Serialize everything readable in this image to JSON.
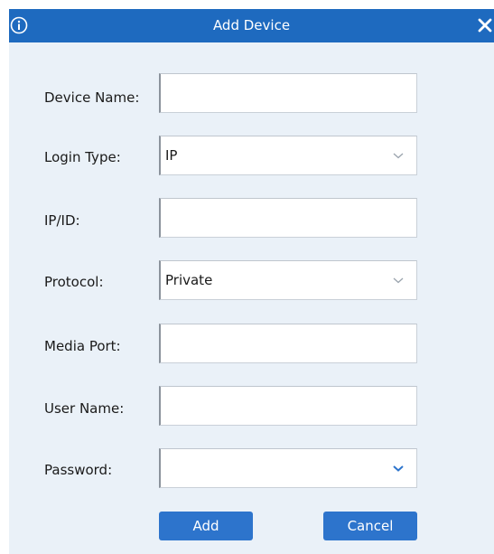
{
  "dialog": {
    "title": "Add Device",
    "colors": {
      "titlebar": "#1e6abf",
      "background": "#eaf1f8",
      "button": "#2d74cc"
    }
  },
  "fields": {
    "device_name": {
      "label": "Device Name:",
      "value": ""
    },
    "login_type": {
      "label": "Login Type:",
      "value": "IP"
    },
    "ip_id": {
      "label": "IP/ID:",
      "value": ""
    },
    "protocol": {
      "label": "Protocol:",
      "value": "Private"
    },
    "media_port": {
      "label": "Media Port:",
      "value": ""
    },
    "user_name": {
      "label": "User Name:",
      "value": ""
    },
    "password": {
      "label": "Password:",
      "value": ""
    }
  },
  "buttons": {
    "add": "Add",
    "cancel": "Cancel"
  },
  "icons": {
    "info": "info-icon",
    "close": "close-icon",
    "dropdown": "chevron-down-icon"
  }
}
